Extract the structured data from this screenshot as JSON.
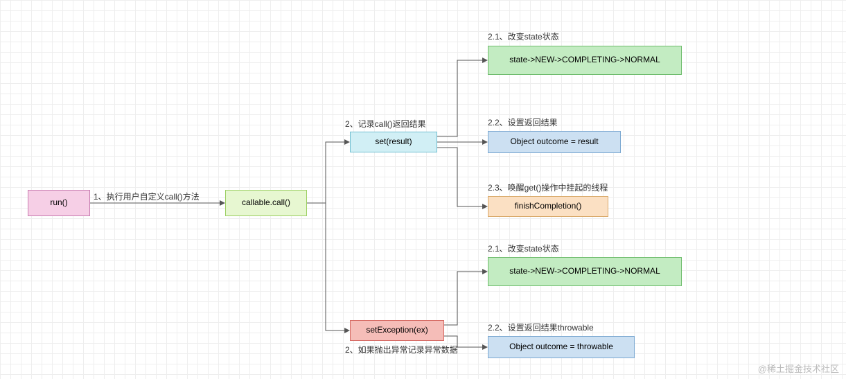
{
  "chart_data": {
    "type": "flowchart",
    "nodes": [
      {
        "id": "run",
        "text": "run()",
        "color": "pink"
      },
      {
        "id": "callable",
        "text": "callable.call()",
        "color": "lime"
      },
      {
        "id": "set",
        "text": "set(result)",
        "color": "aqua"
      },
      {
        "id": "setex",
        "text": "setException(ex)",
        "color": "red"
      },
      {
        "id": "state1",
        "text": "state->NEW->COMPLETING->NORMAL",
        "color": "green"
      },
      {
        "id": "outcome1",
        "text": "Object outcome = result",
        "color": "blue"
      },
      {
        "id": "finish",
        "text": "finishCompletion()",
        "color": "orange"
      },
      {
        "id": "state2",
        "text": "state->NEW->COMPLETING->NORMAL",
        "color": "green"
      },
      {
        "id": "outcome2",
        "text": "Object outcome = throwable",
        "color": "blue"
      }
    ],
    "edges": [
      {
        "from": "run",
        "to": "callable",
        "label": "1、执行用户自定义call()方法"
      },
      {
        "from": "callable",
        "to": "set",
        "label": "2、记录call()返回结果"
      },
      {
        "from": "callable",
        "to": "setex",
        "label": "2、如果抛出异常记录异常数据"
      },
      {
        "from": "set",
        "to": "state1",
        "label": "2.1、改变state状态"
      },
      {
        "from": "set",
        "to": "outcome1",
        "label": "2.2、设置返回结果"
      },
      {
        "from": "set",
        "to": "finish",
        "label": "2.3、唤醒get()操作中挂起的线程"
      },
      {
        "from": "setex",
        "to": "state2",
        "label": "2.1、改变state状态"
      },
      {
        "from": "setex",
        "to": "outcome2",
        "label": "2.2、设置返回结果throwable"
      }
    ]
  },
  "nodes": {
    "run": "run()",
    "callable": "callable.call()",
    "set": "set(result)",
    "setex": "setException(ex)",
    "state1": "state->NEW->COMPLETING->NORMAL",
    "outcome1": "Object outcome = result",
    "finish": "finishCompletion()",
    "state2": "state->NEW->COMPLETING->NORMAL",
    "outcome2": "Object outcome = throwable"
  },
  "labels": {
    "l1": "1、执行用户自定义call()方法",
    "l2a": "2、记录call()返回结果",
    "l2b": "2、如果抛出异常记录异常数据",
    "l21a": "2.1、改变state状态",
    "l22a": "2.2、设置返回结果",
    "l23": "2.3、唤醒get()操作中挂起的线程",
    "l21b": "2.1、改变state状态",
    "l22b": "2.2、设置返回结果throwable"
  },
  "watermark": "@稀土掘金技术社区"
}
